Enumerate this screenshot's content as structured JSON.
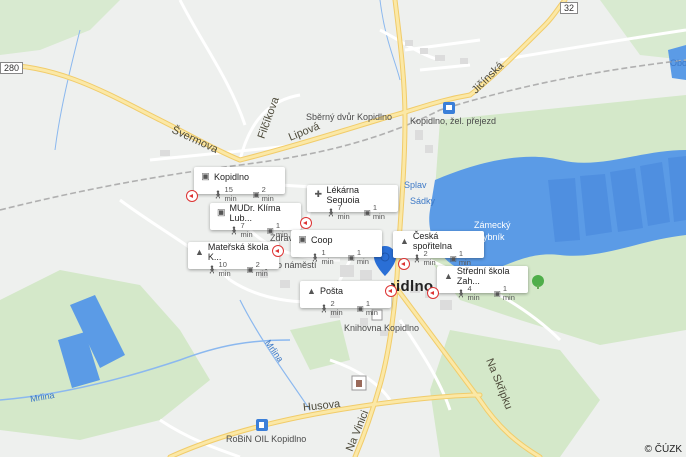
{
  "map": {
    "roads": {
      "svermova": "Švermova",
      "lipova": "Lipová",
      "jicinska": "Jičínská",
      "filcikova": "Filčíkova",
      "husova": "Husova",
      "na_vinici": "Na Vinici",
      "na_skripku": "Na Skřipku",
      "mrlina_1": "Mrlina",
      "mrlina_2": "Mrlina",
      "route_32": "32",
      "route_280": "280"
    },
    "places": {
      "sberny_dvur": "Sběrný dvůr Kopidlno",
      "zel_prejezd": "Kopidlno, žel. přejezd",
      "splav": "Splav",
      "sadky": "Sádky",
      "zamecky_rybnik_1": "Zámecký",
      "zamecky_rybnik_2": "rybník",
      "knihovna": "Knihovna Kopidlno",
      "robin_oil": "RoBiN OIL Kopidlno",
      "obo": "Obo",
      "town": "Kopidlno",
      "namesti": "Bořivojovo náměstí",
      "zdrav": "Zdrav"
    },
    "copyright": "© ČÚZK"
  },
  "pois": [
    {
      "name": "Kopidlno",
      "icon": "bus-stop-icon",
      "walk": "15 min",
      "drive": "2 min"
    },
    {
      "name": "MUDr. Klíma Lub...",
      "icon": "medical-icon",
      "walk": "7 min",
      "drive": "1 min"
    },
    {
      "name": "Lékárna Sequoia",
      "icon": "pharmacy-icon",
      "walk": "7 min",
      "drive": "1 min"
    },
    {
      "name": "Coop",
      "icon": "shopping-cart-icon",
      "walk": "1 min",
      "drive": "1 min"
    },
    {
      "name": "Česká spořitelna",
      "icon": "bank-icon",
      "walk": "2 min",
      "drive": "1 min"
    },
    {
      "name": "Mateřská škola K...",
      "icon": "school-icon",
      "walk": "10 min",
      "drive": "2 min"
    },
    {
      "name": "Pošta",
      "icon": "post-office-icon",
      "walk": "2 min",
      "drive": "1 min"
    },
    {
      "name": "Střední škola Zah...",
      "icon": "school-icon",
      "walk": "4 min",
      "drive": "1 min"
    }
  ],
  "colors": {
    "water": "#5b9be6",
    "major_road": "#f5d37a",
    "pin": "#2a6fd6",
    "green": "#cfe6c4"
  }
}
